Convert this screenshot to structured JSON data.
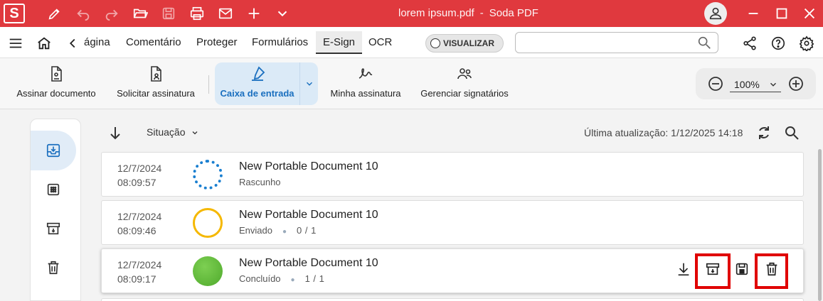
{
  "titlebar": {
    "logo": "S",
    "filename": "lorem ipsum.pdf",
    "separator": "-",
    "app_name": "Soda PDF"
  },
  "menubar": {
    "tabs": [
      "ágina",
      "Comentário",
      "Proteger",
      "Formulários",
      "E-Sign",
      "OCR"
    ],
    "active_tab": "E-Sign",
    "toggle_label": "VISUALIZAR",
    "search_placeholder": ""
  },
  "ribbon": {
    "items": [
      "Assinar documento",
      "Solicitar assinatura",
      "Caixa de entrada",
      "Minha assinatura",
      "Gerenciar signatários"
    ],
    "active_item": "Caixa de entrada",
    "zoom_value": "100%"
  },
  "content": {
    "filter_label": "Situação",
    "last_update": "Última atualização: 1/12/2025 14:18"
  },
  "rows": [
    {
      "date": "12/7/2024",
      "time": "08:09:57",
      "name": "New Portable Document 10",
      "status": "Rascunho",
      "count": "",
      "status_color": "#1a7fd0"
    },
    {
      "date": "12/7/2024",
      "time": "08:09:46",
      "name": "New Portable Document 10",
      "status": "Enviado",
      "count": "0 / 1",
      "status_color": "#f5b800"
    },
    {
      "date": "12/7/2024",
      "time": "08:09:17",
      "name": "New Portable Document 10",
      "status": "Concluído",
      "count": "1 / 1",
      "status_color": "#5cb83a"
    }
  ],
  "colors": {
    "brand_red": "#e0393e",
    "accent_blue": "#1a6fbf",
    "highlight_box": "#e00000"
  }
}
